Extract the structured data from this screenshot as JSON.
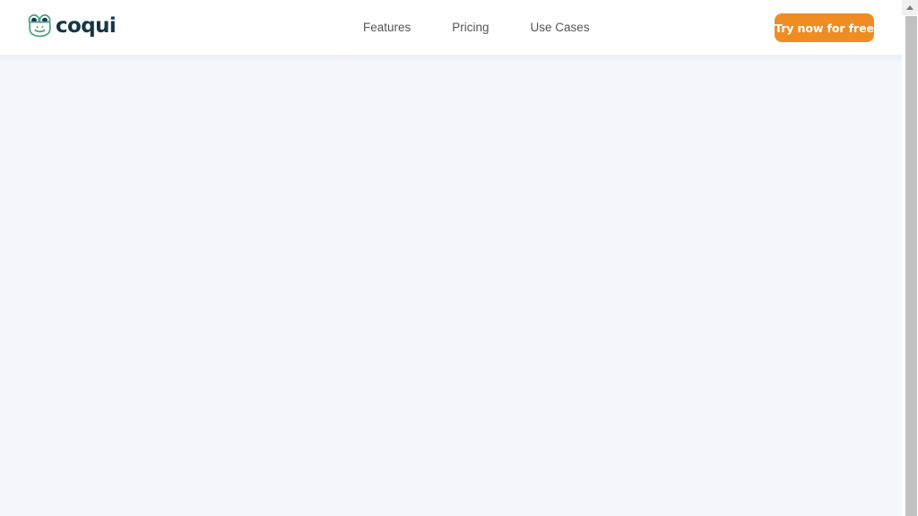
{
  "brand": {
    "name": "coqui",
    "logo_icon": "frog-face-icon",
    "wordmark_color": "#143647",
    "icon_color": "#4aa183"
  },
  "header": {
    "background": "#ffffff",
    "nav_items": [
      {
        "label": "Features"
      },
      {
        "label": "Pricing"
      },
      {
        "label": "Use Cases"
      }
    ],
    "cta": {
      "label": "Try now for free",
      "background": "#ef8d22",
      "text_color": "#ffffff"
    }
  },
  "body": {
    "background": "#f4f8fd",
    "content": ""
  },
  "scrollbar": {
    "up_arrow_icon": "chevron-up-icon",
    "thumb_color": "#c1c1c1",
    "track_color": "#ffffff"
  }
}
